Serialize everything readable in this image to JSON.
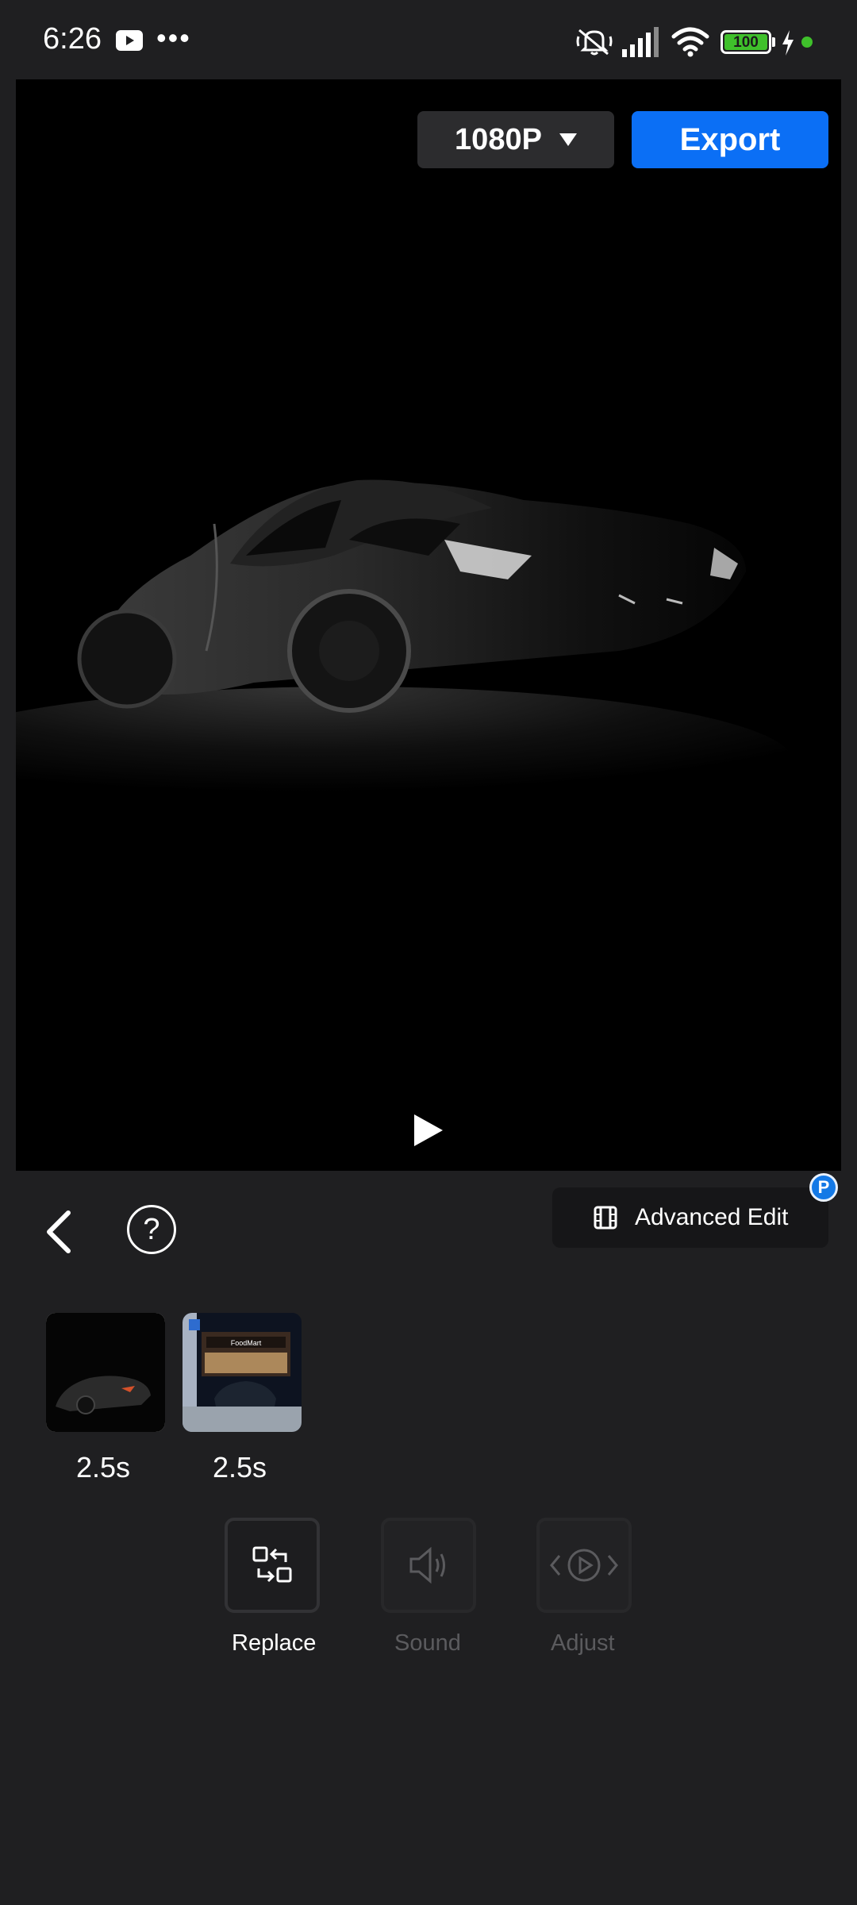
{
  "status_bar": {
    "time": "6:26",
    "battery": "100",
    "icons": [
      "youtube-icon",
      "more-dots-icon",
      "mute-icon",
      "signal-icon",
      "wifi-icon",
      "battery-icon",
      "charging-icon",
      "dot-icon"
    ]
  },
  "preview": {
    "resolution": "1080P",
    "export_label": "Export"
  },
  "toolbar": {
    "advanced_edit": "Advanced Edit",
    "badge": "P"
  },
  "clips": [
    {
      "duration": "2.5s"
    },
    {
      "duration": "2.5s",
      "sign": "FoodMart"
    }
  ],
  "tools": [
    {
      "label": "Replace",
      "icon": "replace-icon"
    },
    {
      "label": "Sound",
      "icon": "sound-icon"
    },
    {
      "label": "Adjust",
      "icon": "adjust-icon"
    }
  ],
  "colors": {
    "accent": "#0b6ff5",
    "background": "#1f1f21",
    "battery_green": "#3fc02b"
  }
}
